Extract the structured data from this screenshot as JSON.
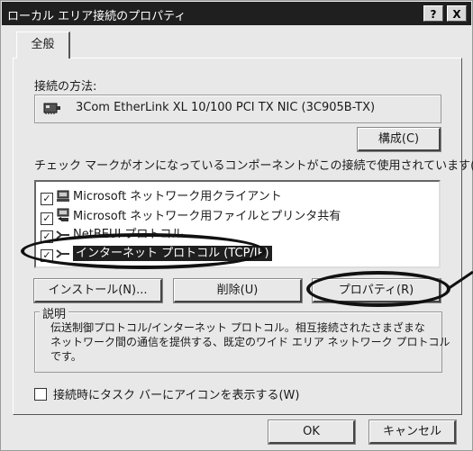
{
  "title": "ローカル エリア接続のプロパティ",
  "title_buttons": {
    "help": "?",
    "close": "X"
  },
  "tab": "全般",
  "connect_using": {
    "label": "接続の方法:",
    "adapter": "3Com EtherLink XL 10/100 PCI TX NIC (3C905B-TX)",
    "configure": "構成(C)"
  },
  "components": {
    "label": "チェック マークがオンになっているコンポーネントがこの接続で使用されています(O):",
    "items": [
      {
        "label": "Microsoft ネットワーク用クライアント",
        "checked": true,
        "icon": "network-client-icon"
      },
      {
        "label": "Microsoft ネットワーク用ファイルとプリンタ共有",
        "checked": true,
        "icon": "file-printer-sharing-icon"
      },
      {
        "label": "NetBEUI プロトコル",
        "checked": true,
        "icon": "protocol-icon"
      },
      {
        "label": "インターネット プロトコル (TCP/IP)",
        "checked": true,
        "selected": true,
        "icon": "protocol-icon"
      }
    ]
  },
  "buttons": {
    "install": "インストール(N)...",
    "uninstall": "削除(U)",
    "properties": "プロパティ(R)"
  },
  "description": {
    "label": "説明",
    "text": [
      "伝送制御プロトコル/インターネット プロトコル。相互接続されたさまざまな",
      "ネットワーク間の通信を提供する、既定のワイド エリア ネットワーク プロトコル",
      "です。"
    ]
  },
  "taskbar_option": {
    "label": "接続時にタスク バーにアイコンを表示する(W)",
    "checked": false
  },
  "footer": {
    "ok": "OK",
    "cancel": "キャンセル"
  },
  "colors": {
    "titlebar": "#1f1f1f",
    "face": "#e8e8e8",
    "selection": "#1f1f1f",
    "highlight_ring": "#111111"
  }
}
